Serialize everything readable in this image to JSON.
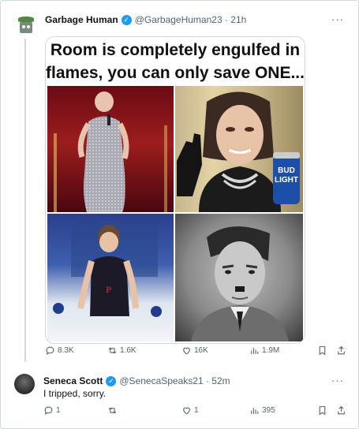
{
  "tweet": {
    "author_name": "Garbage Human",
    "handle_time": "@GarbageHuman23 · 21h",
    "media": {
      "title_line1": "Room is completely engulfed in",
      "title_line2": "flames, you can only save ONE...",
      "can_text": "BUD LIGHT"
    },
    "stats": {
      "replies": "8.3K",
      "retweets": "1.6K",
      "likes": "16K",
      "views": "1.9M"
    }
  },
  "reply": {
    "author_name": "Seneca Scott",
    "handle_time": "@SenecaSpeaks21 · 52m",
    "text": "I tripped, sorry.",
    "stats": {
      "replies": "1",
      "retweets": "",
      "likes": "1",
      "views": "395"
    }
  },
  "colors": {
    "verified": "#1d9bf0",
    "muted": "#536471",
    "border": "#cfd9de"
  },
  "icons": [
    "reply-icon",
    "retweet-icon",
    "like-icon",
    "views-icon",
    "bookmark-icon",
    "share-icon",
    "verified-badge-icon",
    "more-icon"
  ]
}
